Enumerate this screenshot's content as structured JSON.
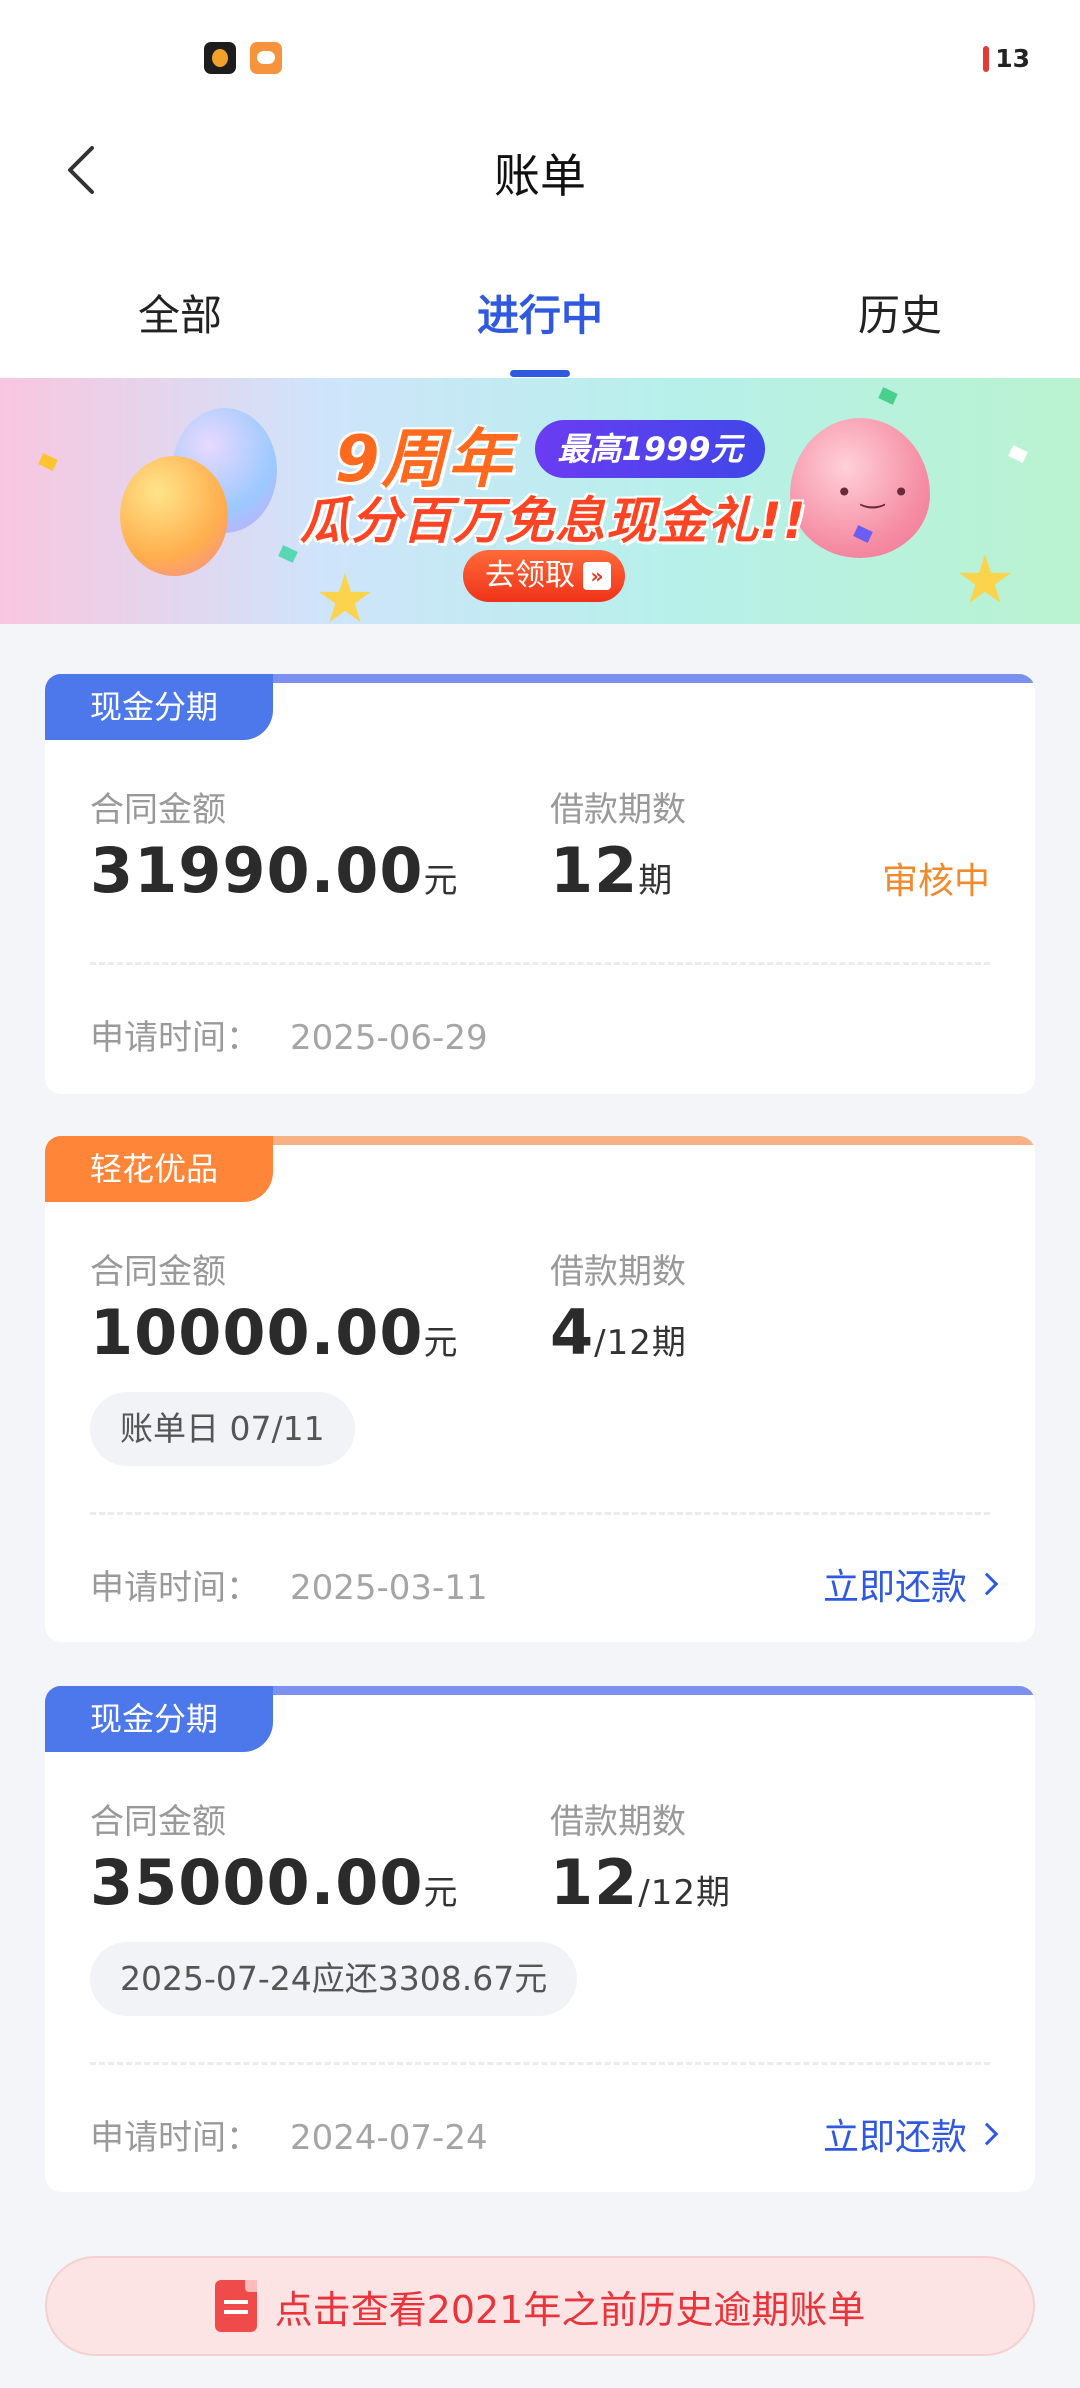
{
  "status_bar": {
    "battery_level": "13",
    "battery_color": "#e53935"
  },
  "nav": {
    "title": "账单"
  },
  "tabs": [
    {
      "label": "全部",
      "active": false
    },
    {
      "label": "进行中",
      "active": true
    },
    {
      "label": "历史",
      "active": false
    }
  ],
  "banner": {
    "title": "9周年",
    "badge": "最高1999元",
    "subtitle": "瓜分百万免息现金礼!!",
    "button": "去领取"
  },
  "cards": [
    {
      "tag": "现金分期",
      "amount_label": "合同金额",
      "amount": "31990.00",
      "amount_unit": "元",
      "period_label": "借款期数",
      "period": "12",
      "period_suffix": "期",
      "status": "审核中",
      "apply_label": "申请时间：",
      "apply_date": "2025-06-29"
    },
    {
      "tag": "轻花优品",
      "amount_label": "合同金额",
      "amount": "10000.00",
      "amount_unit": "元",
      "period_label": "借款期数",
      "period": "4",
      "period_suffix": "/12期",
      "pill": "账单日 07/11",
      "apply_label": "申请时间：",
      "apply_date": "2025-03-11",
      "action": "立即还款"
    },
    {
      "tag": "现金分期",
      "amount_label": "合同金额",
      "amount": "35000.00",
      "amount_unit": "元",
      "period_label": "借款期数",
      "period": "12",
      "period_suffix": "/12期",
      "pill": "2025-07-24应还3308.67元",
      "apply_label": "申请时间：",
      "apply_date": "2024-07-24",
      "action": "立即还款"
    }
  ],
  "history_link": {
    "label": "点击查看2021年之前历史逾期账单"
  },
  "colors": {
    "accent": "#2f59e0",
    "blue_tag": "#4d78ec",
    "orange_tag": "#ff8639",
    "status_orange": "#f08a2e",
    "alert_red": "#e8343a"
  }
}
